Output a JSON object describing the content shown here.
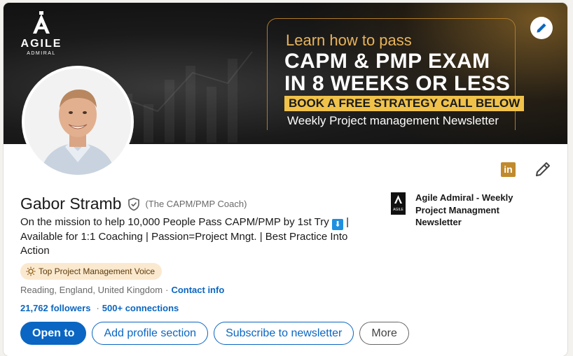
{
  "banner": {
    "logo": {
      "word": "AGILE",
      "sub": "ADMIRAL"
    },
    "promo": {
      "line1": "Learn how to pass",
      "line2": "CAPM & PMP EXAM",
      "line3": "IN 8 WEEKS OR LESS",
      "cta": "BOOK A FREE STRATEGY CALL BELOW",
      "line5": "Weekly Project management Newsletter"
    },
    "edit_icon": "pencil-icon"
  },
  "profile": {
    "name": "Gabor Stramb",
    "pronoun": "(The CAPM/PMP Coach)",
    "headline_part1": "On the mission to help 10,000 People Pass CAPM/PMP by 1st Try",
    "headline_emoji": "⬇",
    "headline_part2": "| Available for 1:1 Coaching | Passion=Project Mngt. | Best Practice Into Action",
    "badge": "Top Project Management Voice",
    "location": "Reading, England, United Kingdom",
    "location_sep": "·",
    "contact_info": "Contact info",
    "followers": "21,762 followers",
    "conn_sep": "·",
    "connections": "500+ connections"
  },
  "company": {
    "name": "Agile Admiral - Weekly Project Managment Newsletter",
    "logo_text": "AGILE"
  },
  "actions": {
    "open_to": "Open to",
    "add_section": "Add profile section",
    "subscribe": "Subscribe to newsletter",
    "more": "More"
  },
  "top_icons": {
    "linkedin": "in"
  },
  "colors": {
    "primary": "#0a66c2",
    "badge_bg": "#fbe9cf",
    "cta_yellow": "#f0c24a",
    "gold": "#c08a2d"
  }
}
